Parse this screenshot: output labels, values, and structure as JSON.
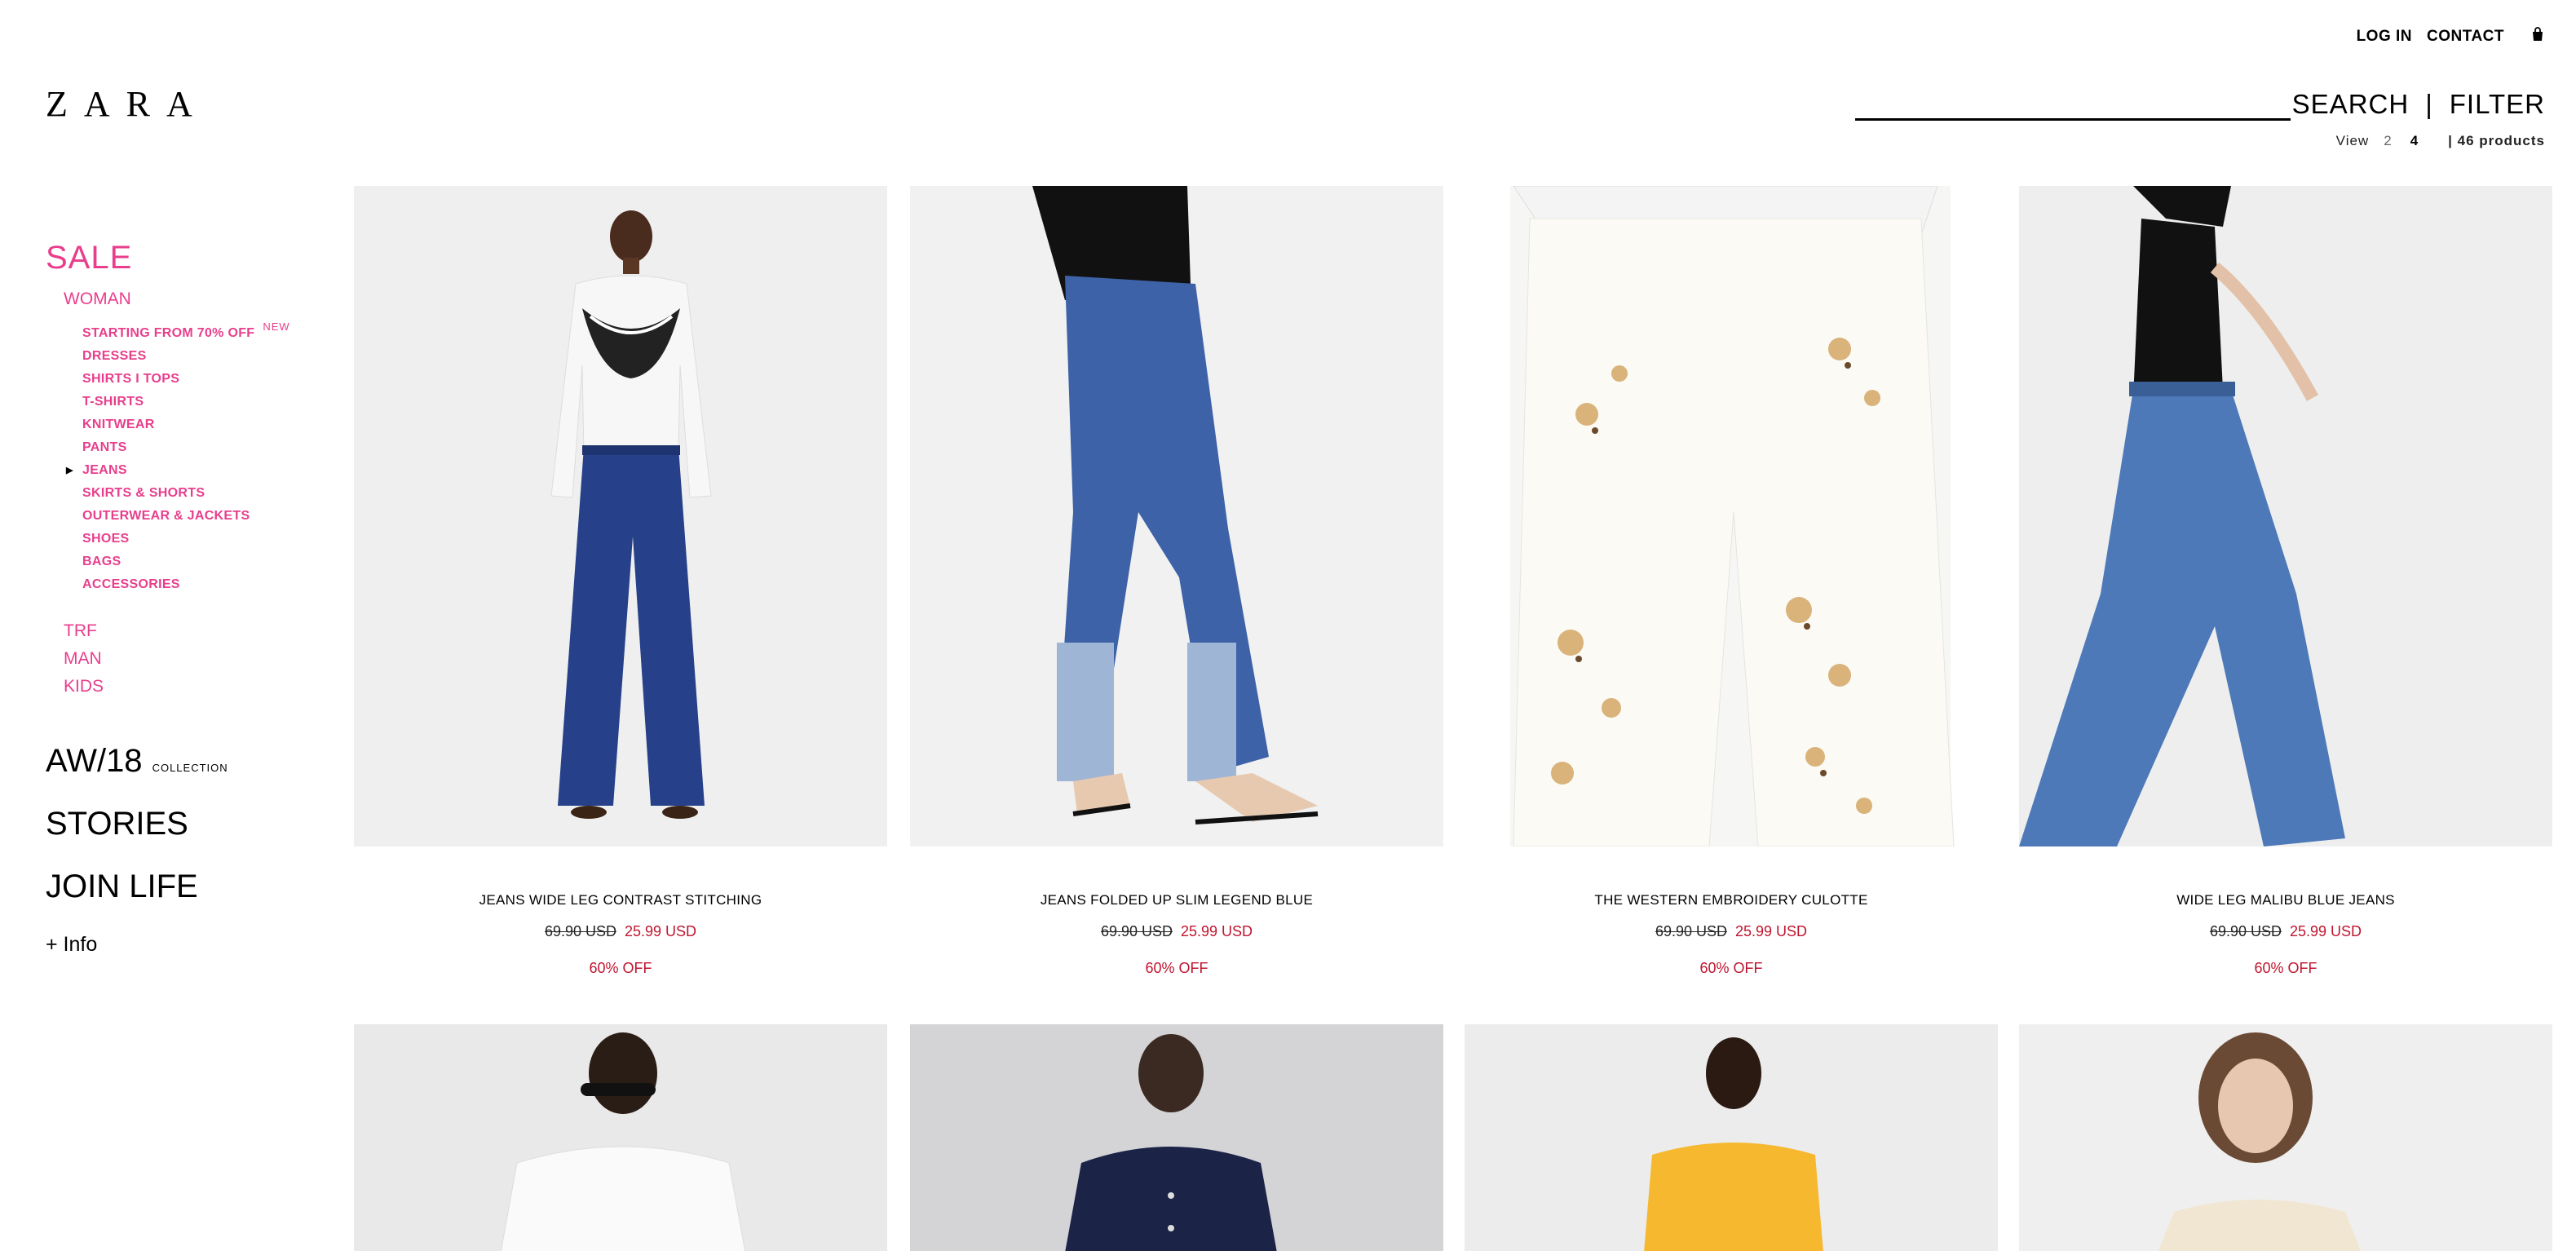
{
  "brand": "ZARA",
  "header": {
    "login": "LOG IN",
    "contact": "CONTACT",
    "search": "SEARCH",
    "separator": "|",
    "filter": "FILTER",
    "view_label": "View",
    "view_opt_2": "2",
    "view_opt_4": "4",
    "count": "| 46 products"
  },
  "sidebar": {
    "sale": "SALE",
    "woman": "WOMAN",
    "subcats": [
      {
        "label": "STARTING FROM 70% OFF",
        "tag": "NEW"
      },
      {
        "label": "DRESSES"
      },
      {
        "label": "SHIRTS I TOPS"
      },
      {
        "label": "T-SHIRTS"
      },
      {
        "label": "KNITWEAR"
      },
      {
        "label": "PANTS"
      },
      {
        "label": "JEANS",
        "active": true
      },
      {
        "label": "SKIRTS & SHORTS"
      },
      {
        "label": "OUTERWEAR & JACKETS"
      },
      {
        "label": "SHOES"
      },
      {
        "label": "BAGS"
      },
      {
        "label": "ACCESSORIES"
      }
    ],
    "topcats": [
      "TRF",
      "MAN",
      "KIDS"
    ],
    "aw18": "AW/18",
    "collection": "COLLECTION",
    "stories": "STORIES",
    "join_life": "JOIN LIFE",
    "info": "+ Info"
  },
  "products": [
    {
      "name": "JEANS WIDE LEG CONTRAST STITCHING",
      "old_price": "69.90 USD",
      "price": "25.99 USD",
      "discount": "60% OFF"
    },
    {
      "name": "JEANS FOLDED UP SLIM LEGEND BLUE",
      "old_price": "69.90 USD",
      "price": "25.99 USD",
      "discount": "60% OFF"
    },
    {
      "name": "THE WESTERN EMBROIDERY CULOTTE",
      "old_price": "69.90 USD",
      "price": "25.99 USD",
      "discount": "60% OFF"
    },
    {
      "name": "WIDE LEG MALIBU BLUE JEANS",
      "old_price": "69.90 USD",
      "price": "25.99 USD",
      "discount": "60% OFF"
    }
  ],
  "colors": {
    "sale_pink": "#e83e8c",
    "price_red": "#c0152f"
  }
}
